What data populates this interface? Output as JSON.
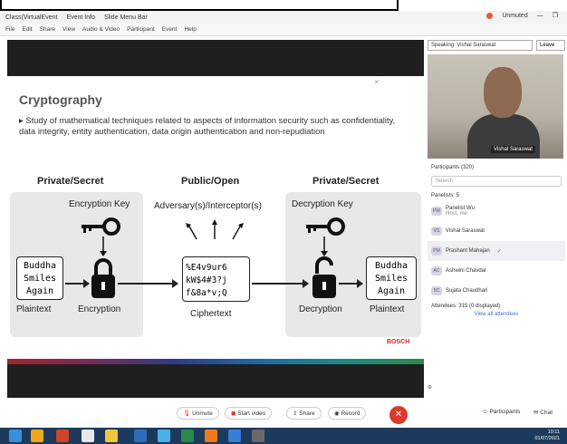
{
  "titlebar": {
    "tabs": [
      "Class(VirtualEvent",
      "Event Info",
      "Slide Menu Bar"
    ],
    "recording": "Unmuted"
  },
  "menubar": [
    "File",
    "Edit",
    "Share",
    "View",
    "Audio & Video",
    "Participant",
    "Event",
    "Help"
  ],
  "share_top": {
    "speaking": "Speaking: Vishal Saraswat",
    "leave": "Leave"
  },
  "slide": {
    "title": "Cryptography",
    "bullet": "Study of mathematical techniques related to aspects of information security such as confidentiality, data integrity, entity authentication, data origin authentication and non-repudiation",
    "headers": {
      "left": "Private/Secret",
      "middle": "Public/Open",
      "right": "Private/Secret"
    },
    "encryption_key": "Encryption Key",
    "decryption_key": "Decryption Key",
    "adversary": "Adversary(s)/Interceptor(s)",
    "plaintext_left": [
      "Buddha",
      "Smiles",
      "Again"
    ],
    "plaintext_right": [
      "Buddha",
      "Smiles",
      "Again"
    ],
    "ciphertext": [
      "%E4v9ur6",
      "kW$4#3?j",
      "f&8a*v;Q"
    ],
    "labels": {
      "plaintext_left": "Plaintext",
      "encryption": "Encryption",
      "ciphertext": "Ciphertext",
      "decryption": "Decryption",
      "plaintext_right": "Plaintext"
    },
    "brand": "BOSCH"
  },
  "video": {
    "name": "Vishal Saraswat"
  },
  "participants": {
    "header": "Participants (320)",
    "search_placeholder": "Search",
    "panelists_label": "Panelists: 5",
    "panelists": [
      {
        "initials": "PW",
        "name": "Panelist Wu",
        "sub": "Host, me"
      },
      {
        "initials": "VS",
        "name": "Vishal Saraswat",
        "sub": ""
      },
      {
        "initials": "PM",
        "name": "Prashant Mahajan",
        "sub": ""
      },
      {
        "initials": "AC",
        "name": "Ashwini Chavdar",
        "sub": ""
      },
      {
        "initials": "SC",
        "name": "Sujata Chaudhari",
        "sub": ""
      }
    ],
    "attendees_label": "Attendees: 315 (0 displayed)",
    "view_all": "View all attendees"
  },
  "controls": {
    "unmute": "Unmute",
    "start_video": "Start video",
    "share": "Share",
    "record": "Record",
    "participants": "Participants",
    "chat": "Chat"
  },
  "clock": {
    "time": "10:11",
    "date": "01/07/2021"
  }
}
